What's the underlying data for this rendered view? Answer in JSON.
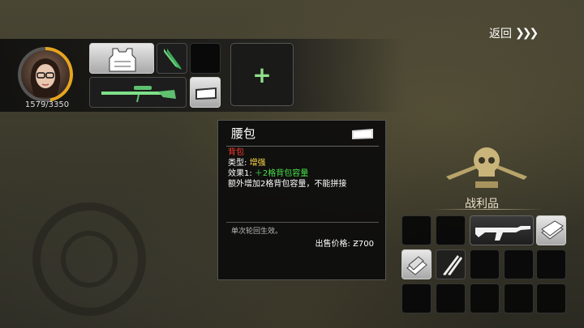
{
  "header": {
    "back_label": "返回",
    "back_arrows": "❯❯❯"
  },
  "player": {
    "hp_text": "1579/3350",
    "hp_fraction": 0.47
  },
  "equipment": {
    "slots": [
      {
        "name": "vest-slot",
        "icon": "armor-vest-icon",
        "style": "light"
      },
      {
        "name": "blade-slot",
        "icon": "green-blade-icon",
        "style": "normal"
      },
      {
        "name": "empty-slot",
        "icon": "",
        "style": "dark"
      },
      {
        "name": "sniper-rifle-slot",
        "icon": "sniper-rifle-icon",
        "style": "normal"
      },
      {
        "name": "waist-pack-slot",
        "icon": "waist-pack-icon",
        "style": "light"
      }
    ],
    "add_symbol": "+"
  },
  "tooltip": {
    "title": "腰包",
    "category": "背包",
    "type_label": "类型:",
    "type_value": "增强",
    "effect_label": "效果1:",
    "effect_value": "＋2格背包容量",
    "description": "额外增加2格背包容量，不能拼接",
    "note": "单次轮回生效。",
    "price_label": "出售价格:",
    "price_value": "Ƶ700"
  },
  "loot": {
    "title": "战利品",
    "items": [
      "",
      "",
      "assault-rifle-icon",
      "",
      "cash-stack-icon",
      "paper-stack-icon",
      "crossed-blades-icon",
      "",
      "",
      "",
      "",
      "",
      "",
      "",
      ""
    ]
  },
  "colors": {
    "accent_green": "#8fe08a",
    "hp_ring": "#e6a520",
    "category_red": "#ff3b30",
    "type_yellow": "#ffd84a",
    "effect_green": "#48e04a"
  }
}
